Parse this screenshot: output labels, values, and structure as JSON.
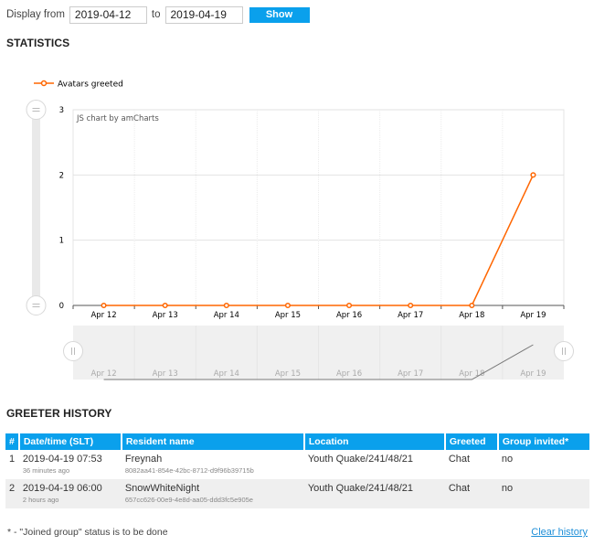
{
  "filter": {
    "display_from_label": "Display from",
    "from_value": "2019-04-12",
    "to_label": "to",
    "to_value": "2019-04-19",
    "show_label": "Show"
  },
  "statistics": {
    "title": "STATISTICS"
  },
  "chart_data": {
    "type": "line",
    "title": "",
    "xlabel": "",
    "ylabel": "",
    "categories": [
      "Apr 12",
      "Apr 13",
      "Apr 14",
      "Apr 15",
      "Apr 16",
      "Apr 17",
      "Apr 18",
      "Apr 19"
    ],
    "series": [
      {
        "name": "Avatars greeted",
        "values": [
          0,
          0,
          0,
          0,
          0,
          0,
          0,
          2
        ],
        "color": "#ff6600"
      }
    ],
    "y_ticks": [
      "0",
      "1",
      "2",
      "3"
    ],
    "ylim": [
      0,
      3
    ],
    "grid": true,
    "legend": "top-left",
    "watermark": "JS chart by amCharts",
    "scrollbar": true
  },
  "history": {
    "title": "GREETER HISTORY",
    "columns": [
      "#",
      "Date/time (SLT)",
      "Resident name",
      "Location",
      "Greeted",
      "Group invited*"
    ],
    "rows": [
      {
        "num": "1",
        "datetime": "2019-04-19 07:53",
        "ago": "36 minutes ago",
        "name": "Freynah",
        "uuid": "8082aa41-854e-42bc-8712-d9f96b39715b",
        "location": "Youth Quake/241/48/21",
        "greeted": "Chat",
        "group_invited": "no"
      },
      {
        "num": "2",
        "datetime": "2019-04-19 06:00",
        "ago": "2 hours ago",
        "name": "SnowWhiteNight",
        "uuid": "657cc626-00e9-4e8d-aa05-ddd3fc5e905e",
        "location": "Youth Quake/241/48/21",
        "greeted": "Chat",
        "group_invited": "no"
      }
    ]
  },
  "footnote": "* - \"Joined group\" status is to be done",
  "clear_history_label": "Clear history"
}
